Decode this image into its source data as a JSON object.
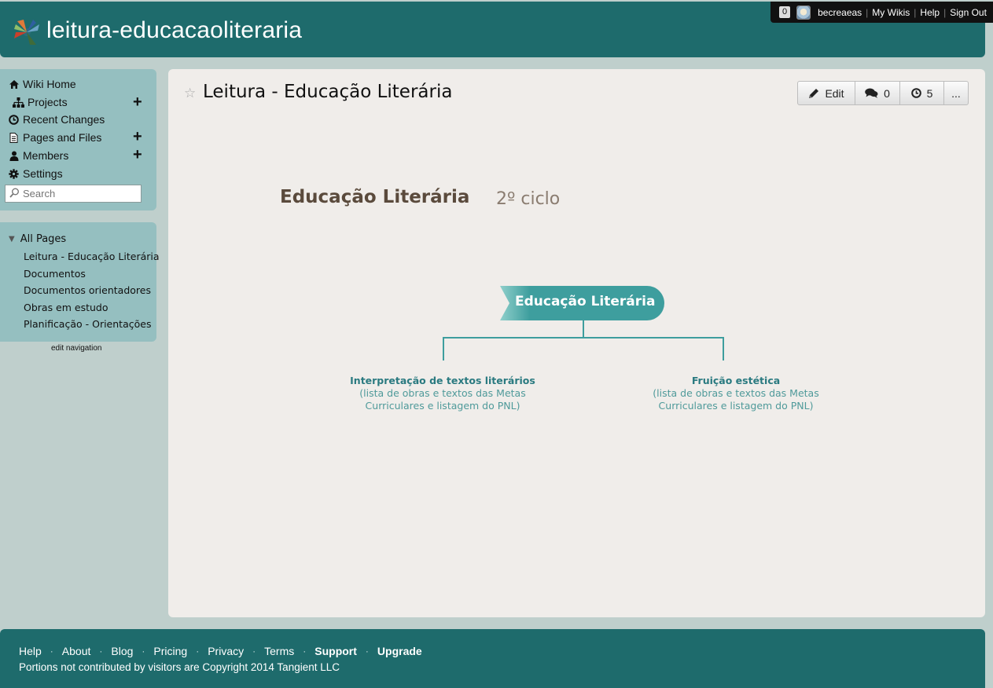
{
  "header": {
    "site_title": "leitura-educacaoliteraria",
    "notification_count": "0",
    "username": "becreaeas",
    "my_wikis": "My Wikis",
    "help": "Help",
    "sign_out": "Sign Out"
  },
  "sidebar": {
    "items": [
      {
        "label": "Wiki Home",
        "icon": "home-icon"
      },
      {
        "label": "Projects",
        "icon": "sitemap-icon"
      },
      {
        "label": "Recent Changes",
        "icon": "clock-icon"
      },
      {
        "label": "Pages and Files",
        "icon": "file-icon"
      },
      {
        "label": "Members",
        "icon": "user-icon"
      },
      {
        "label": "Settings",
        "icon": "gear-icon"
      }
    ],
    "search_placeholder": "Search",
    "all_pages_label": "All Pages",
    "pages": [
      "Leitura - Educação Literária",
      "Documentos",
      "Documentos orientadores",
      "Obras em estudo",
      "Planificação - Orientações"
    ],
    "edit_navigation": "edit navigation"
  },
  "main": {
    "page_title": "Leitura - Educação Literária",
    "toolbar": {
      "edit_label": "Edit",
      "comments_count": "0",
      "history_count": "5",
      "more_label": "..."
    },
    "content": {
      "heading": "Educação Literária",
      "subheading": "2º ciclo",
      "central_node": "Educação Literária",
      "branches": [
        {
          "title": "Interpretação de textos literários",
          "line1": "(lista de obras e textos das Metas",
          "line2": "Curriculares e listagem do PNL)"
        },
        {
          "title": "Fruição estética",
          "line1": "(lista de obras e textos das Metas",
          "line2": "Curriculares e listagem do PNL)"
        }
      ]
    }
  },
  "footer": {
    "links": [
      "Help",
      "About",
      "Blog",
      "Pricing",
      "Privacy",
      "Terms",
      "Support",
      "Upgrade"
    ],
    "copyright": "Portions not contributed by visitors are Copyright 2014 Tangient LLC"
  },
  "colors": {
    "header_bg": "#1e6b6c",
    "sidebar_bg": "#95bfc0",
    "page_bg": "#bfcfcc",
    "content_bg": "#f0edea",
    "mindmap_teal": "#3e9e9e"
  }
}
